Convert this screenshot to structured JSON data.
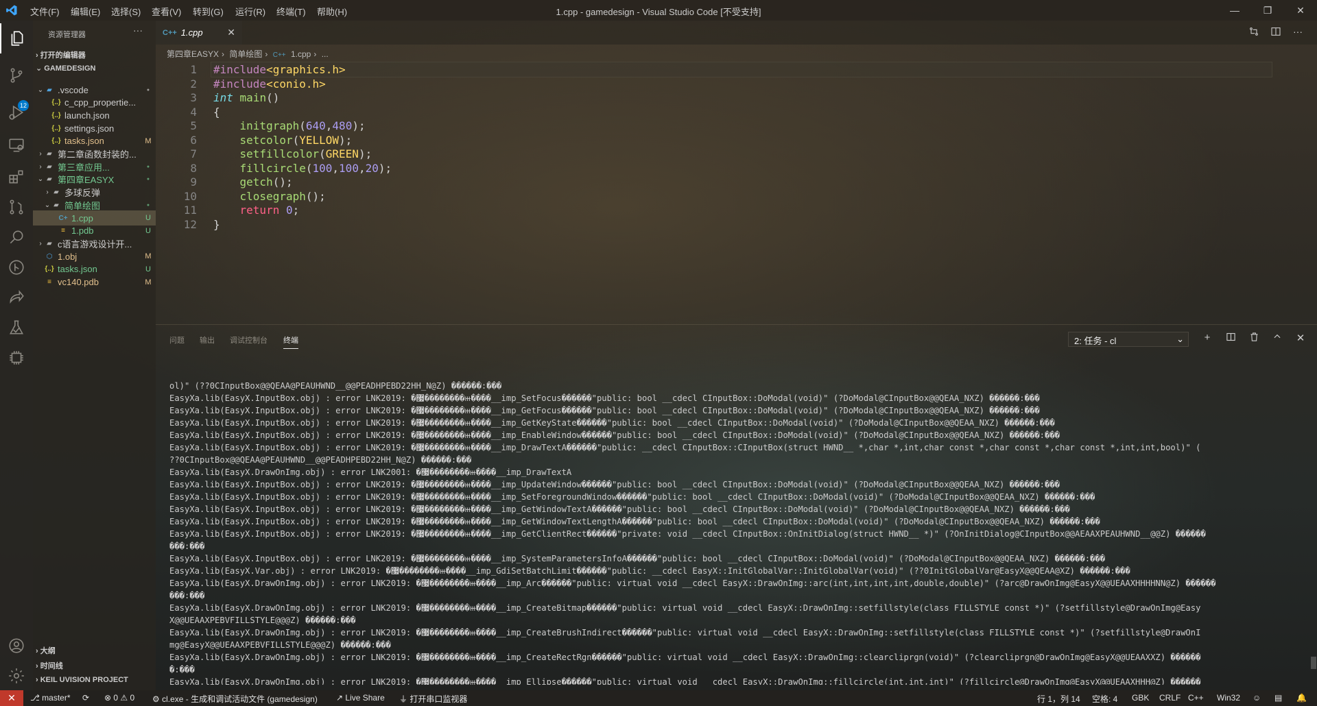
{
  "titlebar": {
    "menu": [
      "文件(F)",
      "编辑(E)",
      "选择(S)",
      "查看(V)",
      "转到(G)",
      "运行(R)",
      "终端(T)",
      "帮助(H)"
    ],
    "title": "1.cpp - gamedesign - Visual Studio Code [不受支持]",
    "controls": {
      "minimize": "—",
      "restore": "❐",
      "close": "✕"
    }
  },
  "activitybar": {
    "scm_badge": "12"
  },
  "sidebar": {
    "title": "资源管理器",
    "more": "···",
    "open_editors": "打开的编辑器",
    "workspace": "GAMEDESIGN",
    "tree": [
      {
        "name": ".vscode",
        "type": "folder-vscode",
        "open": true,
        "depth": 1,
        "badge": "●",
        "color": "#cccccc"
      },
      {
        "name": "c_cpp_propertie...",
        "type": "json",
        "depth": 2,
        "badge": "",
        "color": "#cccccc"
      },
      {
        "name": "launch.json",
        "type": "json",
        "depth": 2,
        "badge": "",
        "color": "#cccccc"
      },
      {
        "name": "settings.json",
        "type": "json",
        "depth": 2,
        "badge": "",
        "color": "#cccccc"
      },
      {
        "name": "tasks.json",
        "type": "json",
        "depth": 2,
        "badge": "M",
        "color": "#e2c08d"
      },
      {
        "name": "第二章函数封装的...",
        "type": "folder",
        "open": false,
        "depth": 1,
        "badge": "",
        "color": "#cccccc"
      },
      {
        "name": "第三章应用...",
        "type": "folder",
        "open": false,
        "depth": 1,
        "badge": "●",
        "color": "#73c991"
      },
      {
        "name": "第四章EASYX",
        "type": "folder",
        "open": true,
        "depth": 1,
        "badge": "●",
        "color": "#73c991"
      },
      {
        "name": "多球反弹",
        "type": "folder",
        "open": false,
        "depth": 2,
        "badge": "",
        "color": "#cccccc"
      },
      {
        "name": "简单绘图",
        "type": "folder",
        "open": true,
        "depth": 2,
        "badge": "●",
        "color": "#73c991"
      },
      {
        "name": "1.cpp",
        "type": "cpp",
        "depth": 3,
        "badge": "U",
        "color": "#73c991",
        "selected": true
      },
      {
        "name": "1.pdb",
        "type": "db",
        "depth": 3,
        "badge": "U",
        "color": "#73c991"
      },
      {
        "name": "c语言游戏设计开...",
        "type": "folder",
        "open": false,
        "depth": 1,
        "badge": "",
        "color": "#cccccc"
      },
      {
        "name": "1.obj",
        "type": "obj",
        "depth": 1,
        "badge": "M",
        "color": "#e2c08d"
      },
      {
        "name": "tasks.json",
        "type": "json",
        "depth": 1,
        "badge": "U",
        "color": "#73c991"
      },
      {
        "name": "vc140.pdb",
        "type": "db",
        "depth": 1,
        "badge": "M",
        "color": "#e2c08d"
      }
    ],
    "bottom_sections": [
      "大纲",
      "时间线",
      "KEIL UVISION PROJECT"
    ]
  },
  "tabs": {
    "active": {
      "label": "1.cpp",
      "icon": "C++"
    },
    "close": "✕"
  },
  "breadcrumb": [
    "第四章EASYX",
    "简单绘图",
    "1.cpp",
    "..."
  ],
  "editor": {
    "lines": [
      [
        {
          "t": "#include",
          "c": "inc"
        },
        {
          "t": "<graphics.h>",
          "c": "hdr"
        }
      ],
      [
        {
          "t": "#include",
          "c": "inc"
        },
        {
          "t": "<conio.h>",
          "c": "hdr"
        }
      ],
      [
        {
          "t": "int",
          "c": "kw"
        },
        {
          "t": " ",
          "c": "p"
        },
        {
          "t": "main",
          "c": "fn"
        },
        {
          "t": "()",
          "c": "p"
        }
      ],
      [
        {
          "t": "{",
          "c": "p"
        }
      ],
      [
        {
          "t": "    ",
          "c": "p"
        },
        {
          "t": "initgraph",
          "c": "fn"
        },
        {
          "t": "(",
          "c": "p"
        },
        {
          "t": "640",
          "c": "num"
        },
        {
          "t": ",",
          "c": "p"
        },
        {
          "t": "480",
          "c": "num"
        },
        {
          "t": ");",
          "c": "p"
        }
      ],
      [
        {
          "t": "    ",
          "c": "p"
        },
        {
          "t": "setcolor",
          "c": "fn"
        },
        {
          "t": "(",
          "c": "p"
        },
        {
          "t": "YELLOW",
          "c": "hdr"
        },
        {
          "t": ");",
          "c": "p"
        }
      ],
      [
        {
          "t": "    ",
          "c": "p"
        },
        {
          "t": "setfillcolor",
          "c": "fn"
        },
        {
          "t": "(",
          "c": "p"
        },
        {
          "t": "GREEN",
          "c": "hdr"
        },
        {
          "t": ");",
          "c": "p"
        }
      ],
      [
        {
          "t": "    ",
          "c": "p"
        },
        {
          "t": "fillcircle",
          "c": "fn"
        },
        {
          "t": "(",
          "c": "p"
        },
        {
          "t": "100",
          "c": "num"
        },
        {
          "t": ",",
          "c": "p"
        },
        {
          "t": "100",
          "c": "num"
        },
        {
          "t": ",",
          "c": "p"
        },
        {
          "t": "20",
          "c": "num"
        },
        {
          "t": ");",
          "c": "p"
        }
      ],
      [
        {
          "t": "    ",
          "c": "p"
        },
        {
          "t": "getch",
          "c": "fn"
        },
        {
          "t": "();",
          "c": "p"
        }
      ],
      [
        {
          "t": "    ",
          "c": "p"
        },
        {
          "t": "closegraph",
          "c": "fn"
        },
        {
          "t": "();",
          "c": "p"
        }
      ],
      [
        {
          "t": "    ",
          "c": "p"
        },
        {
          "t": "return",
          "c": "ret"
        },
        {
          "t": " ",
          "c": "p"
        },
        {
          "t": "0",
          "c": "num"
        },
        {
          "t": ";",
          "c": "p"
        }
      ],
      [
        {
          "t": "}",
          "c": "p"
        }
      ]
    ]
  },
  "panel": {
    "tabs": [
      "问题",
      "输出",
      "调试控制台",
      "终端"
    ],
    "active_tab": "终端",
    "terminal_select": "2: 任务 - cl",
    "actions": {
      "add": "+",
      "split": "⊟",
      "trash": "🗑",
      "maximize": "^",
      "close": "✕"
    },
    "terminal_lines": [
      "ol)\" (??0CInputBox@@QEAA@PEAUHWND__@@PEADHPEBD22HH_N@Z) ������:���",
      "EasyXa.lib(EasyX.InputBox.obj) : error LNK2019: �޷��������ⲿ����__imp_SetFocus������\"public: bool __cdecl CInputBox::DoModal(void)\" (?DoModal@CInputBox@@QEAA_NXZ) ������:���",
      "EasyXa.lib(EasyX.InputBox.obj) : error LNK2019: �޷��������ⲿ����__imp_GetFocus������\"public: bool __cdecl CInputBox::DoModal(void)\" (?DoModal@CInputBox@@QEAA_NXZ) ������:���",
      "EasyXa.lib(EasyX.InputBox.obj) : error LNK2019: �޷��������ⲿ����__imp_GetKeyState������\"public: bool __cdecl CInputBox::DoModal(void)\" (?DoModal@CInputBox@@QEAA_NXZ) ������:���",
      "EasyXa.lib(EasyX.InputBox.obj) : error LNK2019: �޷��������ⲿ����__imp_EnableWindow������\"public: bool __cdecl CInputBox::DoModal(void)\" (?DoModal@CInputBox@@QEAA_NXZ) ������:���",
      "EasyXa.lib(EasyX.InputBox.obj) : error LNK2019: �޷��������ⲿ����__imp_DrawTextA������\"public: __cdecl CInputBox::CInputBox(struct HWND__ *,char *,int,char const *,char const *,char const *,int,int,bool)\" (",
      "??0CInputBox@@QEAA@PEAUHWND__@@PEADHPEBD22HH_N@Z) ������:���",
      "EasyXa.lib(EasyX.DrawOnImg.obj) : error LNK2001: �޷��������ⲿ����__imp_DrawTextA",
      "EasyXa.lib(EasyX.InputBox.obj) : error LNK2019: �޷��������ⲿ����__imp_UpdateWindow������\"public: bool __cdecl CInputBox::DoModal(void)\" (?DoModal@CInputBox@@QEAA_NXZ) ������:���",
      "EasyXa.lib(EasyX.InputBox.obj) : error LNK2019: �޷��������ⲿ����__imp_SetForegroundWindow������\"public: bool __cdecl CInputBox::DoModal(void)\" (?DoModal@CInputBox@@QEAA_NXZ) ������:���",
      "EasyXa.lib(EasyX.InputBox.obj) : error LNK2019: �޷��������ⲿ����__imp_GetWindowTextA������\"public: bool __cdecl CInputBox::DoModal(void)\" (?DoModal@CInputBox@@QEAA_NXZ) ������:���",
      "EasyXa.lib(EasyX.InputBox.obj) : error LNK2019: �޷��������ⲿ����__imp_GetWindowTextLengthA������\"public: bool __cdecl CInputBox::DoModal(void)\" (?DoModal@CInputBox@@QEAA_NXZ) ������:���",
      "EasyXa.lib(EasyX.InputBox.obj) : error LNK2019: �޷��������ⲿ����__imp_GetClientRect������\"private: void __cdecl CInputBox::OnInitDialog(struct HWND__ *)\" (?OnInitDialog@CInputBox@@AEAAXPEAUHWND__@@Z) ������",
      "���:���",
      "EasyXa.lib(EasyX.InputBox.obj) : error LNK2019: �޷��������ⲿ����__imp_SystemParametersInfoA������\"public: bool __cdecl CInputBox::DoModal(void)\" (?DoModal@CInputBox@@QEAA_NXZ) ������:���",
      "EasyXa.lib(EasyX.Var.obj) : error LNK2019: �޷��������ⲿ����__imp_GdiSetBatchLimit������\"public: __cdecl EasyX::InitGlobalVar::InitGlobalVar(void)\" (??0InitGlobalVar@EasyX@@QEAA@XZ) ������:���",
      "EasyXa.lib(EasyX.DrawOnImg.obj) : error LNK2019: �޷��������ⲿ����__imp_Arc������\"public: virtual void __cdecl EasyX::DrawOnImg::arc(int,int,int,int,double,double)\" (?arc@DrawOnImg@EasyX@@UEAAXHHHHNN@Z) ������",
      "���:���",
      "EasyXa.lib(EasyX.DrawOnImg.obj) : error LNK2019: �޷��������ⲿ����__imp_CreateBitmap������\"public: virtual void __cdecl EasyX::DrawOnImg::setfillstyle(class FILLSTYLE const *)\" (?setfillstyle@DrawOnImg@Easy",
      "X@@UEAAXPEBVFILLSTYLE@@@Z) ������:���",
      "EasyXa.lib(EasyX.DrawOnImg.obj) : error LNK2019: �޷��������ⲿ����__imp_CreateBrushIndirect������\"public: virtual void __cdecl EasyX::DrawOnImg::setfillstyle(class FILLSTYLE const *)\" (?setfillstyle@DrawOnI",
      "mg@EasyX@@UEAAXPEBVFILLSTYLE@@@Z) ������:���",
      "EasyXa.lib(EasyX.DrawOnImg.obj) : error LNK2019: �޷��������ⲿ����__imp_CreateRectRgn������\"public: virtual void __cdecl EasyX::DrawOnImg::clearcliprgn(void)\" (?clearcliprgn@DrawOnImg@EasyX@@UEAAXXZ) ������",
      "�:���",
      "EasyXa.lib(EasyX.DrawOnImg.obj) : error LNK2019: �޷��������ⲿ����__imp_Ellipse������\"public: virtual void __cdecl EasyX::DrawOnImg::fillcircle(int,int,int)\" (?fillcircle@DrawOnImg@EasyX@@UEAAXHHH@Z) ������"
    ]
  },
  "statusbar": {
    "remote": "✕",
    "branch": "master*",
    "sync": "⟳",
    "problems": "⊗ 0 ⚠ 0",
    "task": "cl.exe - 生成和调试活动文件 (gamedesign)",
    "liveshare": "Live Share",
    "serial": "打开串口监视器",
    "position": "行 1，列 14",
    "spaces": "空格: 4",
    "encoding": "GBK",
    "eol": "CRLF",
    "language": "C++",
    "platform": "Win32"
  },
  "colors": {
    "accent": "#007acc",
    "untracked": "#73c991",
    "modified": "#e2c08d",
    "remote": "#c0392b"
  }
}
